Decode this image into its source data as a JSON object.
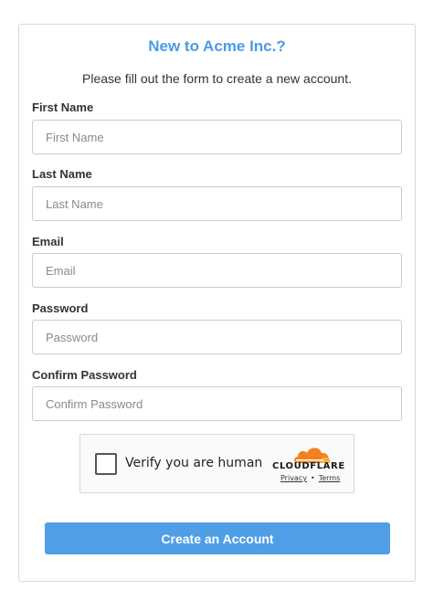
{
  "form": {
    "title": "New to Acme Inc.?",
    "subtitle": "Please fill out the form to create a new account.",
    "fields": [
      {
        "label": "First Name",
        "placeholder": "First Name",
        "value": ""
      },
      {
        "label": "Last Name",
        "placeholder": "Last Name",
        "value": ""
      },
      {
        "label": "Email",
        "placeholder": "Email",
        "value": ""
      },
      {
        "label": "Password",
        "placeholder": "Password",
        "value": ""
      },
      {
        "label": "Confirm Password",
        "placeholder": "Confirm Password",
        "value": ""
      }
    ],
    "submit_label": "Create an Account"
  },
  "captcha": {
    "text": "Verify you are human",
    "brand": "CLOUDFLARE",
    "privacy_label": "Privacy",
    "separator": "•",
    "terms_label": "Terms",
    "checked": false
  },
  "colors": {
    "accent": "#4f9ee6",
    "title": "#4a9be6",
    "cloudflare_orange": "#f38020",
    "cloudflare_light": "#faae40"
  }
}
